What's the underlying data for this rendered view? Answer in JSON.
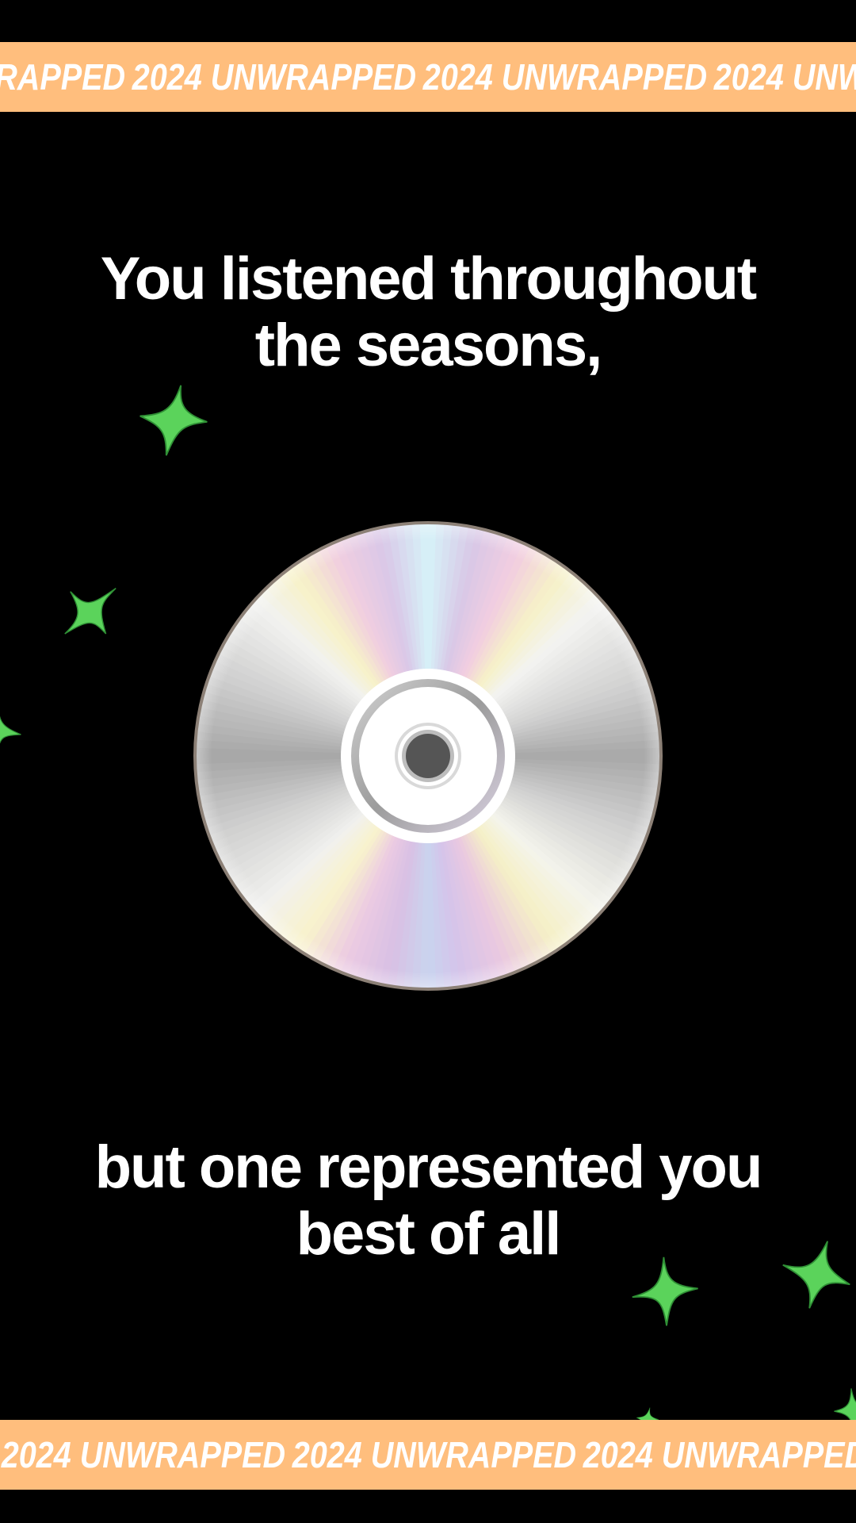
{
  "banner": {
    "text": "2024 UNWRAPPED",
    "background_color": "#FFBE7D",
    "text_color": "#FFFFFF"
  },
  "headline_top": {
    "line1": "You listened throughout",
    "line2": "the seasons,"
  },
  "headline_bottom": {
    "line1": "but one represented you",
    "line2": "best of all"
  },
  "sparkle_color": "#5BD35B",
  "disc_icon": "compact-disc-icon",
  "sparkle_icon": "four-point-star-icon"
}
